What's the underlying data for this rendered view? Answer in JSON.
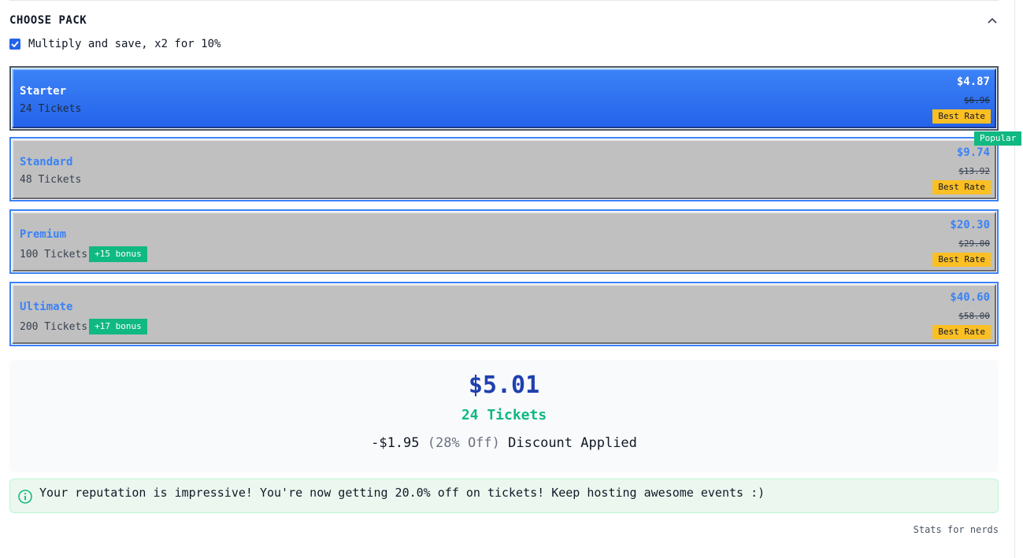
{
  "header": {
    "title": "CHOOSE PACK"
  },
  "multiply": {
    "label": "Multiply and save, x2 for 10%",
    "checked": true
  },
  "popular_badge": "Popular",
  "packs": [
    {
      "name": "Starter",
      "tickets": "24 Tickets",
      "bonus": "",
      "price": "$4.87",
      "old_price": "$6.96",
      "badge": "Best Rate",
      "selected": true
    },
    {
      "name": "Standard",
      "tickets": "48 Tickets",
      "bonus": "",
      "price": "$9.74",
      "old_price": "$13.92",
      "badge": "Best Rate",
      "selected": false
    },
    {
      "name": "Premium",
      "tickets": "100 Tickets",
      "bonus": "+15 bonus",
      "price": "$20.30",
      "old_price": "$29.00",
      "badge": "Best Rate",
      "selected": false
    },
    {
      "name": "Ultimate",
      "tickets": "200 Tickets",
      "bonus": "+17 bonus",
      "price": "$40.60",
      "old_price": "$58.00",
      "badge": "Best Rate",
      "selected": false
    }
  ],
  "summary": {
    "price": "$5.01",
    "tickets": "24 Tickets",
    "discount_amount": "-$1.95",
    "discount_percent": "(28% Off)",
    "discount_label": "Discount Applied"
  },
  "info": {
    "message": "Your reputation is impressive! You're now getting 20.0% off on tickets! Keep hosting awesome events :)"
  },
  "footer": {
    "stats_link": "Stats for nerds"
  },
  "colors": {
    "accent": "#3b82f6",
    "selected_gradient_top": "#3b82f6",
    "selected_gradient_bottom": "#2563eb",
    "bonus_green": "#10b981",
    "best_rate_yellow": "#fbbf24",
    "summary_price_blue": "#1e40af"
  }
}
